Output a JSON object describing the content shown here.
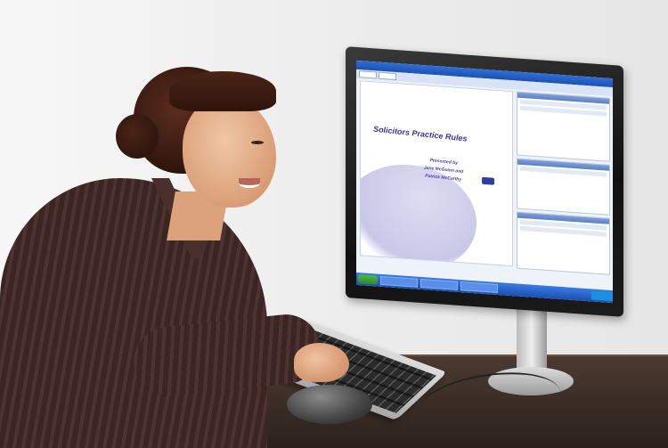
{
  "slide": {
    "title": "Solicitors Practice Rules",
    "presenter_line1": "Presented by",
    "presenter_line2": "Jane McGuinn and",
    "presenter_line3": "Patrick McCarthy"
  },
  "colors": {
    "slide_text": "#3b2f9a",
    "taskbar": "#1b4fb4",
    "shirt": "#3a2522",
    "desk": "#3a2c25"
  }
}
